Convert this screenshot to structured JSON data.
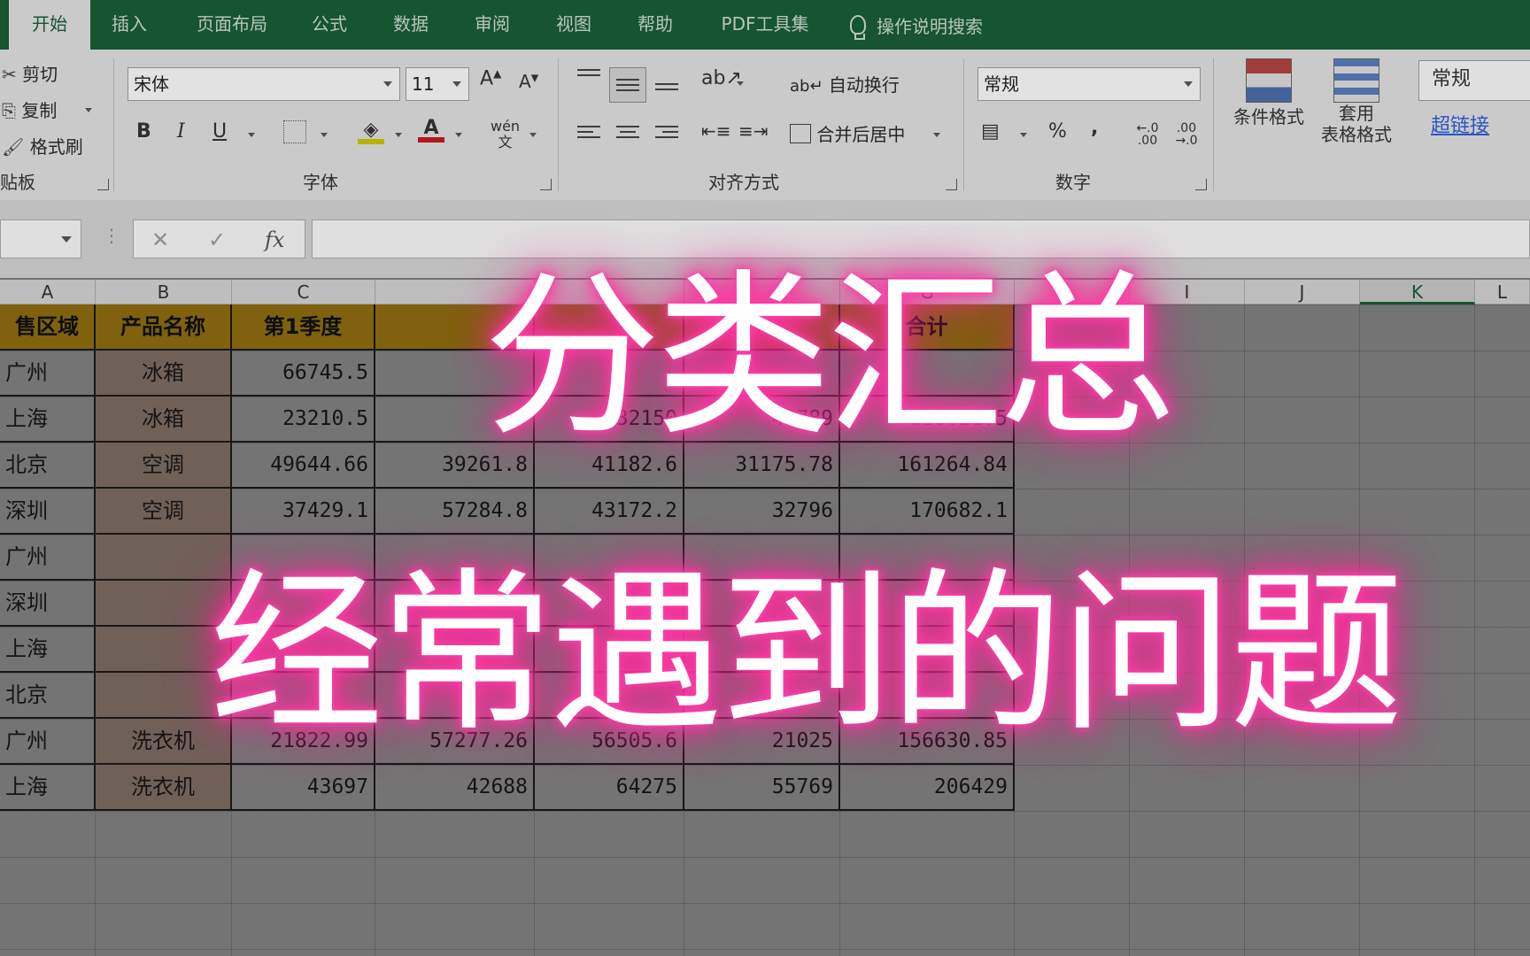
{
  "tabs": [
    "开始",
    "插入",
    "页面布局",
    "公式",
    "数据",
    "审阅",
    "视图",
    "帮助",
    "PDF工具集"
  ],
  "tell_me": "操作说明搜索",
  "clipboard": {
    "cut": "剪切",
    "copy": "复制",
    "painter": "格式刷",
    "label": "贴板"
  },
  "font": {
    "name": "宋体",
    "size": "11",
    "bold": "B",
    "italic": "I",
    "underline": "U",
    "phonetic": "wén",
    "label": "字体"
  },
  "alignment": {
    "wrap": "自动换行",
    "merge": "合并后居中",
    "label": "对齐方式"
  },
  "number": {
    "format": "常规",
    "percent": "%",
    "comma": ",",
    "inc": "←.0 .00",
    "dec": ".00 →.0",
    "label": "数字"
  },
  "styles": {
    "conditional": "条件格式",
    "table_a": "套用",
    "table_b": "表格格式",
    "style_normal": "常规",
    "style_link": "超链接"
  },
  "formula_bar": {
    "fx": "fx"
  },
  "columns": [
    "A",
    "B",
    "C",
    "",
    "",
    "",
    "G",
    "",
    "I",
    "J",
    "K",
    "L"
  ],
  "table": {
    "headers": [
      "售区域",
      "产品名称",
      "第1季度",
      "",
      "",
      "",
      "合计"
    ],
    "rows": [
      [
        "广州",
        "冰箱",
        "66745.5",
        "",
        "",
        "",
        ""
      ],
      [
        "上海",
        "冰箱",
        "23210.5",
        "",
        "32150",
        "43789",
        "126021.5"
      ],
      [
        "北京",
        "空调",
        "49644.66",
        "39261.8",
        "41182.6",
        "31175.78",
        "161264.84"
      ],
      [
        "深圳",
        "空调",
        "37429.1",
        "57284.8",
        "43172.2",
        "32796",
        "170682.1"
      ],
      [
        "广州",
        "",
        "",
        "",
        "",
        "",
        ""
      ],
      [
        "深圳",
        "",
        "",
        "",
        "",
        "",
        ""
      ],
      [
        "上海",
        "",
        "",
        "",
        "",
        "",
        ""
      ],
      [
        "北京",
        "",
        "",
        "",
        "",
        "",
        ""
      ],
      [
        "广州",
        "洗衣机",
        "21822.99",
        "57277.26",
        "56505.6",
        "21025",
        "156630.85"
      ],
      [
        "上海",
        "洗衣机",
        "43697",
        "42688",
        "64275",
        "55769",
        "206429"
      ]
    ]
  },
  "overlay": {
    "line1": "分类汇总",
    "line2": "经常遇到的问题"
  }
}
